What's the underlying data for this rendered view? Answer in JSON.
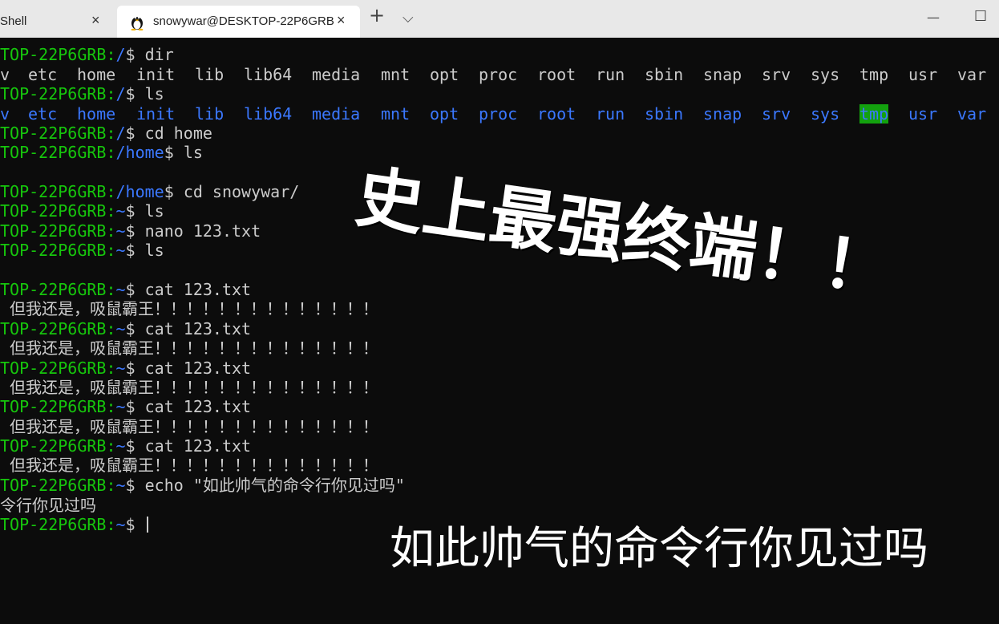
{
  "tabs": [
    {
      "label": "Shell",
      "close": "×"
    },
    {
      "label": "snowywar@DESKTOP-22P6GRB",
      "close": "×",
      "icon": "linux-tux-icon"
    }
  ],
  "titlebar": {
    "new_tab": "+",
    "dropdown": "⌵",
    "minimize": "—",
    "maximize": "☐"
  },
  "prompts": {
    "root": "TOP-22P6GRB:",
    "home": "TOP-22P6GRB:",
    "user": "TOP-22P6GRB:",
    "path_root": "/",
    "path_home": "/home",
    "path_user": "~",
    "dollar": "$ "
  },
  "commands": {
    "dir": "dir",
    "ls": "ls",
    "cd_home": "cd home",
    "cd_user": "cd snowywar/",
    "nano": "nano 123.txt",
    "cat": "cat 123.txt",
    "echo": "echo \"如此帅气的命令行你见过吗\""
  },
  "dir_entries": [
    "v",
    "etc",
    "home",
    "init",
    "lib",
    "lib64",
    "media",
    "mnt",
    "opt",
    "proc",
    "root",
    "run",
    "sbin",
    "snap",
    "srv",
    "sys",
    "tmp",
    "usr",
    "var"
  ],
  "cat_output": " 但我还是，吸鼠霸王！！！！！！！！！！！！！！",
  "echo_output": "令行你见过吗",
  "overlay": {
    "title": "史上最强终端！！",
    "subtitle": "如此帅气的命令行你见过吗"
  },
  "colors": {
    "prompt_green": "#16c60c",
    "path_blue": "#3b78ff",
    "text": "#cccccc",
    "background": "#0c0c0c",
    "tmp_highlight": "#13a10e"
  }
}
